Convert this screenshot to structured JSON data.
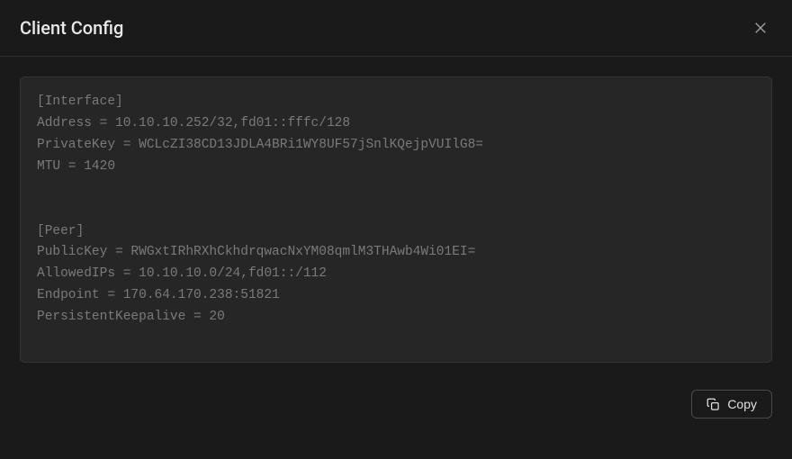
{
  "modal": {
    "title": "Client Config"
  },
  "config": {
    "text": "[Interface]\nAddress = 10.10.10.252/32,fd01::fffc/128\nPrivateKey = WCLcZI38CD13JDLA4BRi1WY8UF57jSnlKQejpVUIlG8=\nMTU = 1420\n\n\n[Peer]\nPublicKey = RWGxtIRhRXhCkhdrqwacNxYM08qmlM3THAwb4Wi01EI=\nAllowedIPs = 10.10.10.0/24,fd01::/112\nEndpoint = 170.64.170.238:51821\nPersistentKeepalive = 20"
  },
  "actions": {
    "copy_label": "Copy"
  }
}
